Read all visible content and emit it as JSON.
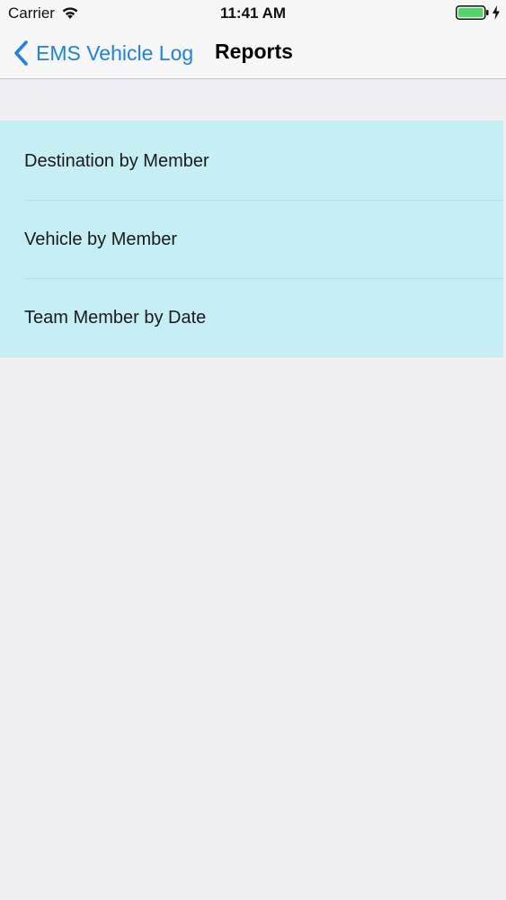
{
  "status_bar": {
    "carrier": "Carrier",
    "time": "11:41 AM",
    "wifi_icon": "wifi-icon",
    "battery_icon": "battery-icon",
    "charging_icon": "bolt-icon",
    "battery_color": "#4cd964"
  },
  "nav": {
    "back_label": "EMS Vehicle Log",
    "title": "Reports",
    "accent_color": "#1a82e8"
  },
  "list": {
    "background_color": "#c5eff5",
    "items": [
      {
        "label": "Destination by Member"
      },
      {
        "label": "Vehicle by Member"
      },
      {
        "label": "Team Member by Date"
      }
    ]
  }
}
